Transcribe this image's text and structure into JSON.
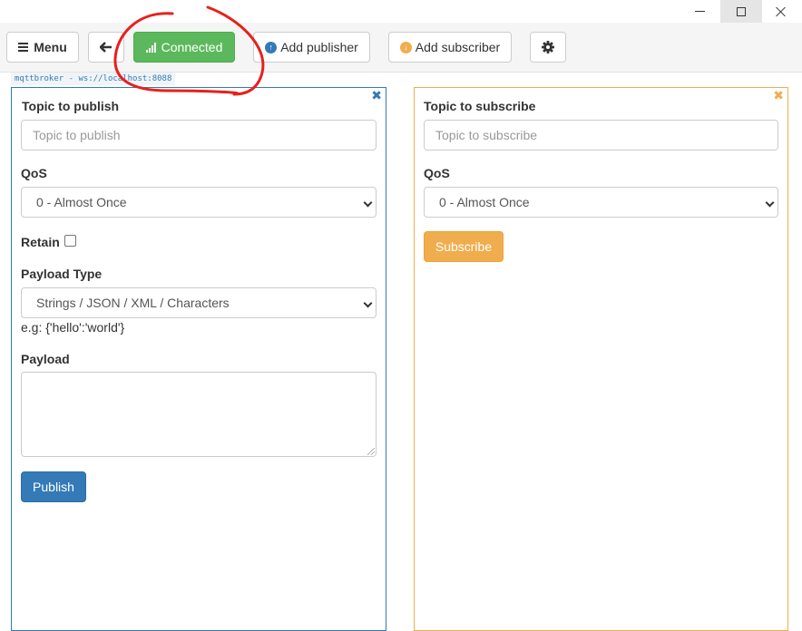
{
  "window": {
    "minimize_icon": "minimize-icon",
    "maximize_icon": "maximize-icon",
    "close_icon": "close-icon"
  },
  "toolbar": {
    "menu_label": "Menu",
    "menu_icon": "hamburger-icon",
    "back_icon": "arrow-left-icon",
    "connected_label": "Connected",
    "connected_icon": "signal-bars-icon",
    "add_publisher_label": "Add publisher",
    "add_publisher_icon": "arrow-up-circle-icon",
    "add_subscriber_label": "Add subscriber",
    "add_subscriber_icon": "arrow-down-circle-icon",
    "settings_icon": "gear-icon"
  },
  "broker": {
    "label": "mqttbroker - ws://localhost:8088"
  },
  "publisher": {
    "close_glyph": "✖",
    "topic_label": "Topic to publish",
    "topic_placeholder": "Topic to publish",
    "qos_label": "QoS",
    "qos_value": "0 - Almost Once",
    "retain_label": "Retain",
    "retain_checked": false,
    "payload_type_label": "Payload Type",
    "payload_type_value": "Strings / JSON / XML / Characters",
    "payload_hint": "e.g: {'hello':'world'}",
    "payload_label": "Payload",
    "payload_value": "",
    "publish_label": "Publish"
  },
  "subscriber": {
    "close_glyph": "✖",
    "topic_label": "Topic to subscribe",
    "topic_placeholder": "Topic to subscribe",
    "qos_label": "QoS",
    "qos_value": "0 - Almost Once",
    "subscribe_label": "Subscribe"
  },
  "colors": {
    "connected": "#5cb85c",
    "publisher_accent": "#337ab7",
    "subscriber_accent": "#f0ad4e",
    "annotation": "#e8201c"
  }
}
